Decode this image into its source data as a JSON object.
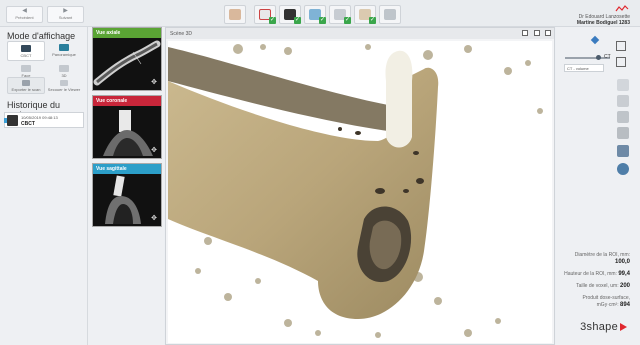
{
  "topbar": {
    "prev_label": "Précédent",
    "next_label": "Suivant",
    "user_name": "Dr Edouard Lanzosette",
    "clinic_name": "Martine Bodiguel 1283"
  },
  "left": {
    "display_mode_title": "Mode d'affichage",
    "view_ct": "CBCT",
    "view_panoramic": "Panoramique",
    "view_face": "Face",
    "view_3d": "3D",
    "export_label": "Exporter le scan",
    "secondary_label": "Secouer le Viewer",
    "history_title": "Historique du patient",
    "history": [
      {
        "date": "10/05/2019 09:48:13",
        "type": "CBCT"
      }
    ]
  },
  "thumbs": [
    {
      "label": "Vue axiale",
      "color": "#5aa434"
    },
    {
      "label": "Vue coronale",
      "color": "#c8263a"
    },
    {
      "label": "Vue sagittale",
      "color": "#2c9fc9"
    }
  ],
  "scene": {
    "title": "Scène 3D"
  },
  "right": {
    "slider_value": "CT",
    "slider_sub": "CT - volume",
    "roi_diam_label": "Diamètre de la ROI, mm:",
    "roi_diam_value": "100,0",
    "roi_height_label": "Hauteur de la ROI, mm:",
    "roi_height_value": "99,4",
    "voxel_label": "Taille de voxel, um:",
    "voxel_value": "200",
    "dose_label_1": "Produit dose-surface,",
    "dose_label_2": "mGy·cm²:",
    "dose_value": "894",
    "brand": "3shape"
  },
  "colors": {
    "accent": "#2c9fc9",
    "check": "#3aa64b",
    "brand_red": "#e0282f"
  }
}
